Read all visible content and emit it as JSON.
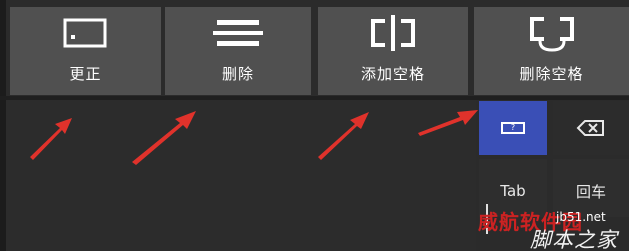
{
  "gesture_buttons": [
    {
      "id": "correct",
      "label": "更正",
      "icon": "rectangle-dot-icon"
    },
    {
      "id": "delete",
      "label": "删除",
      "icon": "strikethrough-lines-icon"
    },
    {
      "id": "add_space",
      "label": "添加空格",
      "icon": "split-brackets-icon"
    },
    {
      "id": "delete_space",
      "label": "删除空格",
      "icon": "join-brackets-icon"
    }
  ],
  "keypad": {
    "ime_key": {
      "label": "?",
      "icon": "keyboard-toggle-icon",
      "color": "#3a4fb6"
    },
    "backspace_key": {
      "icon": "backspace-icon"
    },
    "tab_key": {
      "label": "Tab"
    },
    "enter_key": {
      "label": "回车"
    }
  },
  "annotations": {
    "arrow_color": "#e0322b",
    "arrow_count": 4
  },
  "watermark": {
    "left_text": "威航软件园",
    "url_text": "jb51.net",
    "right_text": "脚本之家"
  }
}
